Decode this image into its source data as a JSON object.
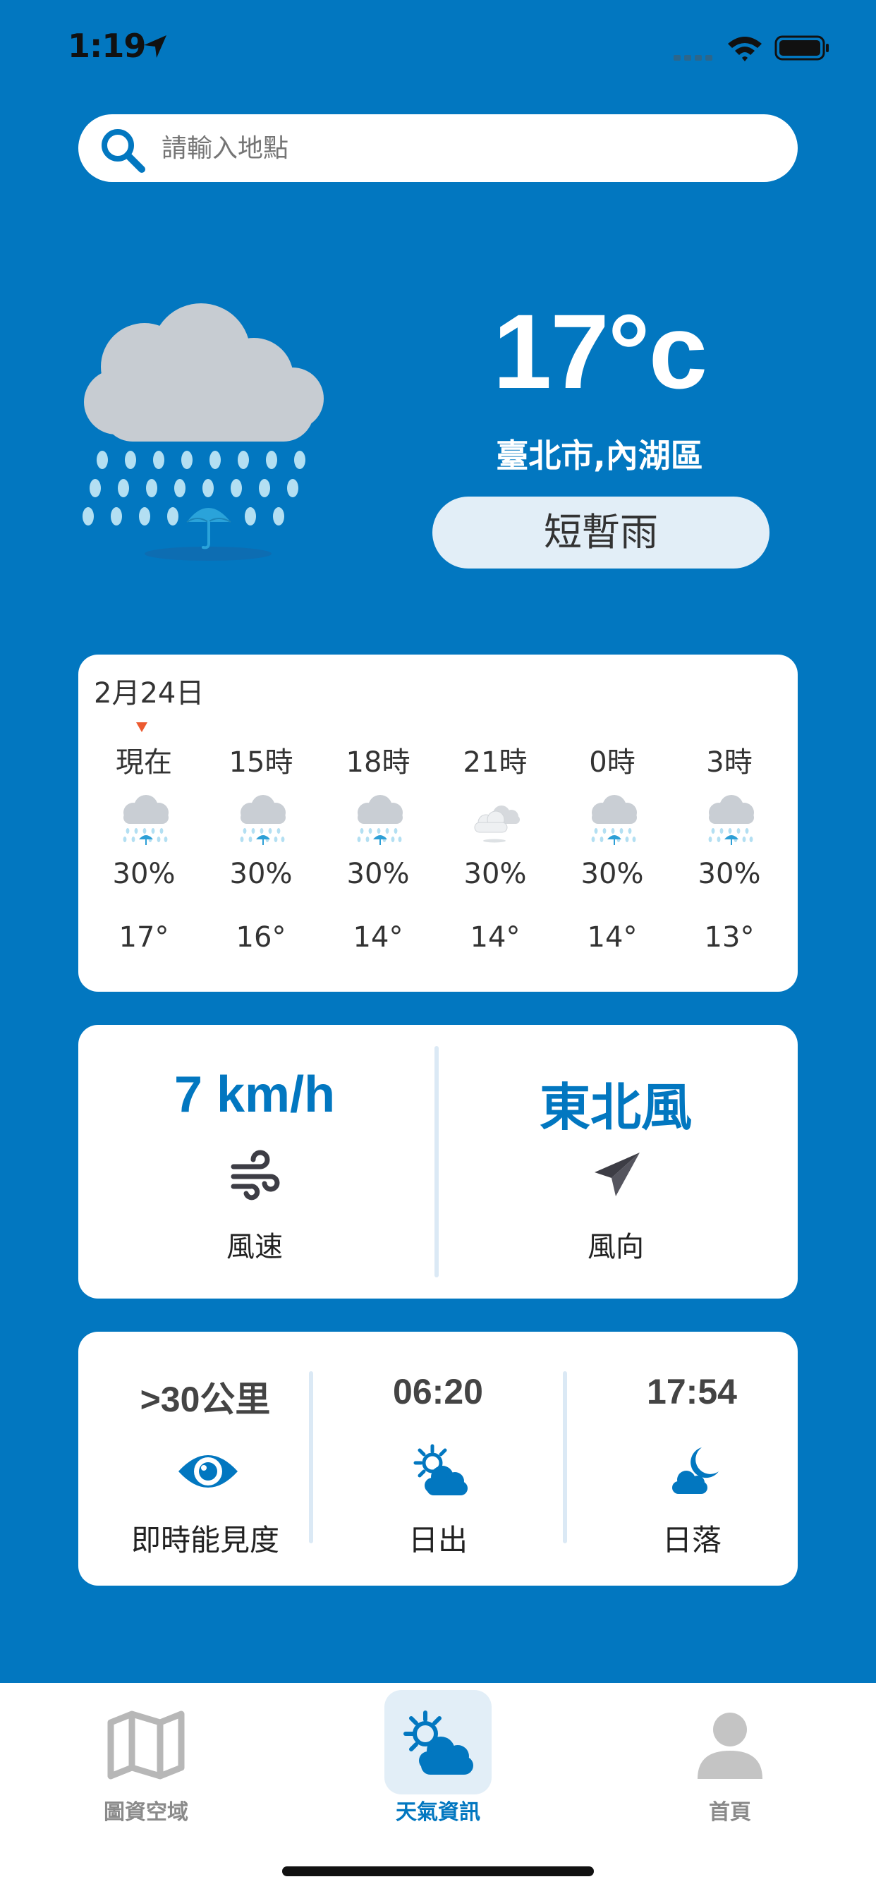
{
  "status_bar": {
    "time": "1:19"
  },
  "search": {
    "placeholder": "請輸入地點",
    "value": ""
  },
  "current": {
    "temperature": "17°c",
    "location": "臺北市,內湖區",
    "condition": "短暫雨",
    "icon": "rain-umbrella-icon"
  },
  "hourly": {
    "date": "2月24日",
    "items": [
      {
        "label": "現在",
        "pop": "30%",
        "temp": "17°",
        "icon": "rain-icon",
        "is_now": true
      },
      {
        "label": "15時",
        "pop": "30%",
        "temp": "16°",
        "icon": "rain-icon"
      },
      {
        "label": "18時",
        "pop": "30%",
        "temp": "14°",
        "icon": "rain-icon"
      },
      {
        "label": "21時",
        "pop": "30%",
        "temp": "14°",
        "icon": "cloudy-icon"
      },
      {
        "label": "0時",
        "pop": "30%",
        "temp": "14°",
        "icon": "rain-icon"
      },
      {
        "label": "3時",
        "pop": "30%",
        "temp": "13°",
        "icon": "rain-icon"
      }
    ]
  },
  "wind": {
    "speed_value": "7 km/h",
    "speed_label": "風速",
    "speed_icon": "wind-icon",
    "direction_value": "東北風",
    "direction_label": "風向",
    "direction_icon": "paper-plane-icon"
  },
  "sun": {
    "visibility_value": ">30公里",
    "visibility_label": "即時能見度",
    "visibility_icon": "eye-icon",
    "sunrise_value": "06:20",
    "sunrise_label": "日出",
    "sunrise_icon": "sun-cloud-icon",
    "sunset_value": "17:54",
    "sunset_label": "日落",
    "sunset_icon": "moon-cloud-icon"
  },
  "tabs": [
    {
      "label": "圖資空域",
      "icon": "map-icon",
      "active": false
    },
    {
      "label": "天氣資訊",
      "icon": "sun-cloud-icon",
      "active": true
    },
    {
      "label": "首頁",
      "icon": "person-icon",
      "active": false
    }
  ],
  "colors": {
    "background": "#0277c0",
    "accent": "#0277c0",
    "pill": "#e2eef7",
    "now_marker": "#ec5a30",
    "tab_inactive": "#8a8a8a"
  }
}
